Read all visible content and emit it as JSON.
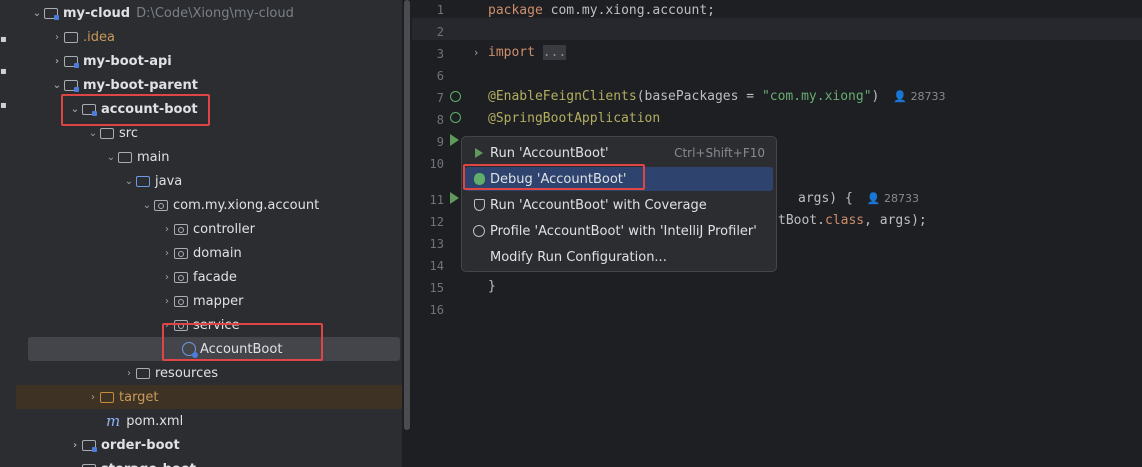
{
  "tree": {
    "root_label": "my-cloud",
    "root_path": "D:\\Code\\Xiong\\my-cloud",
    "idea": ".idea",
    "api": "my-boot-api",
    "parent": "my-boot-parent",
    "account": "account-boot",
    "src": "src",
    "main": "main",
    "java": "java",
    "pkg": "com.my.xiong.account",
    "controller": "controller",
    "domain": "domain",
    "facade": "facade",
    "mapper": "mapper",
    "service": "service",
    "accountboot": "AccountBoot",
    "resources": "resources",
    "target": "target",
    "pom": "pom.xml",
    "order": "order-boot",
    "storage": "storage-boot"
  },
  "code": {
    "lines": {
      "l1_kw": "package",
      "l1_rest": " com.my.xiong.account;",
      "l3_kw": "import",
      "l3_dots": "...",
      "l7_ann": "@EnableFeignClients",
      "l7_mid": "(basePackages = ",
      "l7_str": "\"com.my.xiong\"",
      "l7_end": ")",
      "l7_ref": "28733",
      "l8_ann": "@SpringBootApplication",
      "l11_tail": "args) {",
      "l11_ref": "28733",
      "l12_tail": "tBoot.",
      "l12_kw": "class",
      "l12_end": ", args);",
      "l15": "}"
    },
    "numbers": [
      "1",
      "2",
      "3",
      "6",
      "7",
      "8",
      "9",
      "10",
      "11",
      "12",
      "13",
      "14",
      "15",
      "16"
    ]
  },
  "popup": {
    "run": "Run 'AccountBoot'",
    "run_shortcut": "Ctrl+Shift+F10",
    "debug": "Debug 'AccountBoot'",
    "coverage": "Run 'AccountBoot' with Coverage",
    "profile": "Profile 'AccountBoot' with 'IntelliJ Profiler'",
    "modify": "Modify Run Configuration..."
  },
  "colors": {
    "annotation_red": "#e04545",
    "selection_blue": "#2e436e"
  }
}
